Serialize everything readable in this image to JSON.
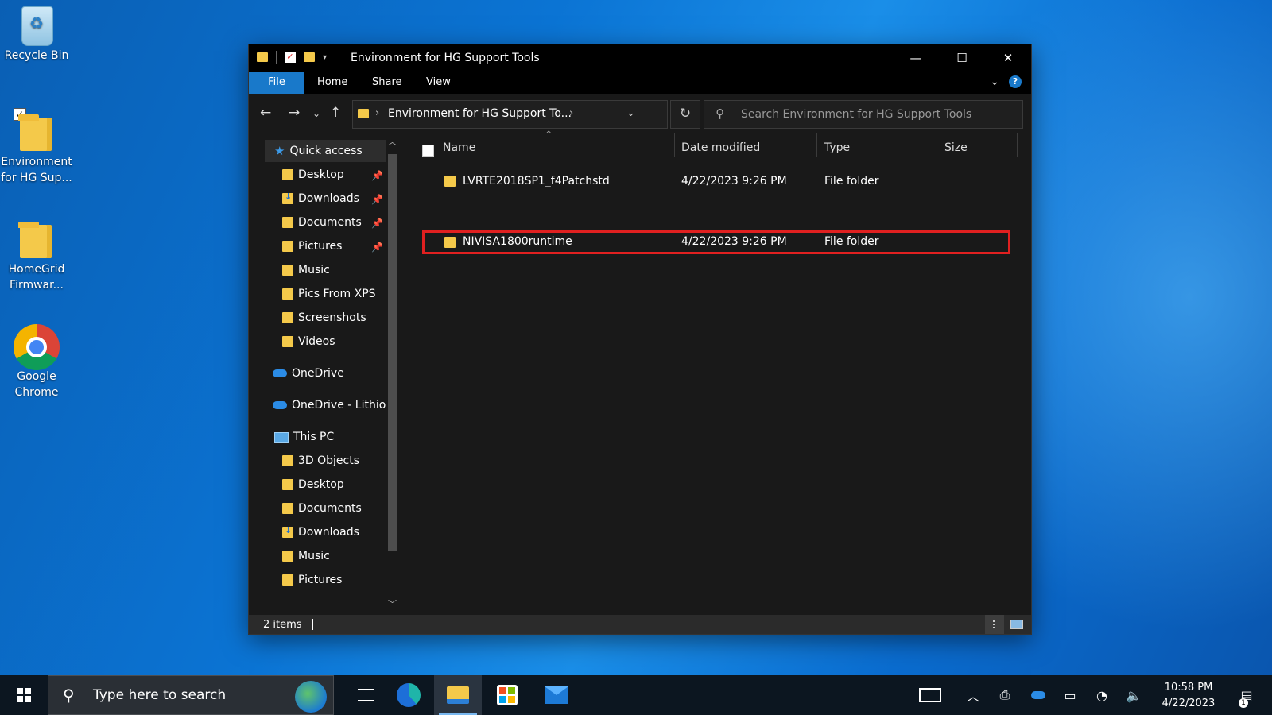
{
  "desktop": {
    "icons": [
      {
        "label_line1": "Recycle Bin",
        "label_line2": ""
      },
      {
        "label_line1": "Environment",
        "label_line2": "for HG Sup..."
      },
      {
        "label_line1": "HomeGrid",
        "label_line2": "Firmwar..."
      },
      {
        "label_line1": "Google",
        "label_line2": "Chrome"
      }
    ]
  },
  "window": {
    "title": "Environment for HG Support Tools",
    "ribbon_tabs": [
      "File",
      "Home",
      "Share",
      "View"
    ],
    "help_label": "?",
    "address_text": "Environment for HG Support To...",
    "search_placeholder": "Search Environment for HG Support Tools",
    "nav": {
      "quick_access": "Quick access",
      "quick_items": [
        {
          "label": "Desktop",
          "pinned": true
        },
        {
          "label": "Downloads",
          "pinned": true
        },
        {
          "label": "Documents",
          "pinned": true
        },
        {
          "label": "Pictures",
          "pinned": true
        },
        {
          "label": "Music",
          "pinned": false
        },
        {
          "label": "Pics From XPS",
          "pinned": false
        },
        {
          "label": "Screenshots",
          "pinned": false
        },
        {
          "label": "Videos",
          "pinned": false
        }
      ],
      "onedrive": "OneDrive",
      "onedrive_org": "OneDrive - Lithion",
      "this_pc": "This PC",
      "pc_items": [
        "3D Objects",
        "Desktop",
        "Documents",
        "Downloads",
        "Music",
        "Pictures"
      ]
    },
    "columns": [
      "Name",
      "Date modified",
      "Type",
      "Size"
    ],
    "rows": [
      {
        "name": "LVRTE2018SP1_f4Patchstd",
        "date": "4/22/2023 9:26 PM",
        "type": "File folder",
        "size": ""
      },
      {
        "name": "NIVISA1800runtime",
        "date": "4/22/2023 9:26 PM",
        "type": "File folder",
        "size": "",
        "highlighted": true
      }
    ],
    "status": "2 items"
  },
  "taskbar": {
    "search_text": "Type here to search",
    "time": "10:58 PM",
    "date": "4/22/2023",
    "notification_count": "1"
  },
  "colors": {
    "accent": "#1979ca",
    "highlight_box": "#e02020"
  }
}
